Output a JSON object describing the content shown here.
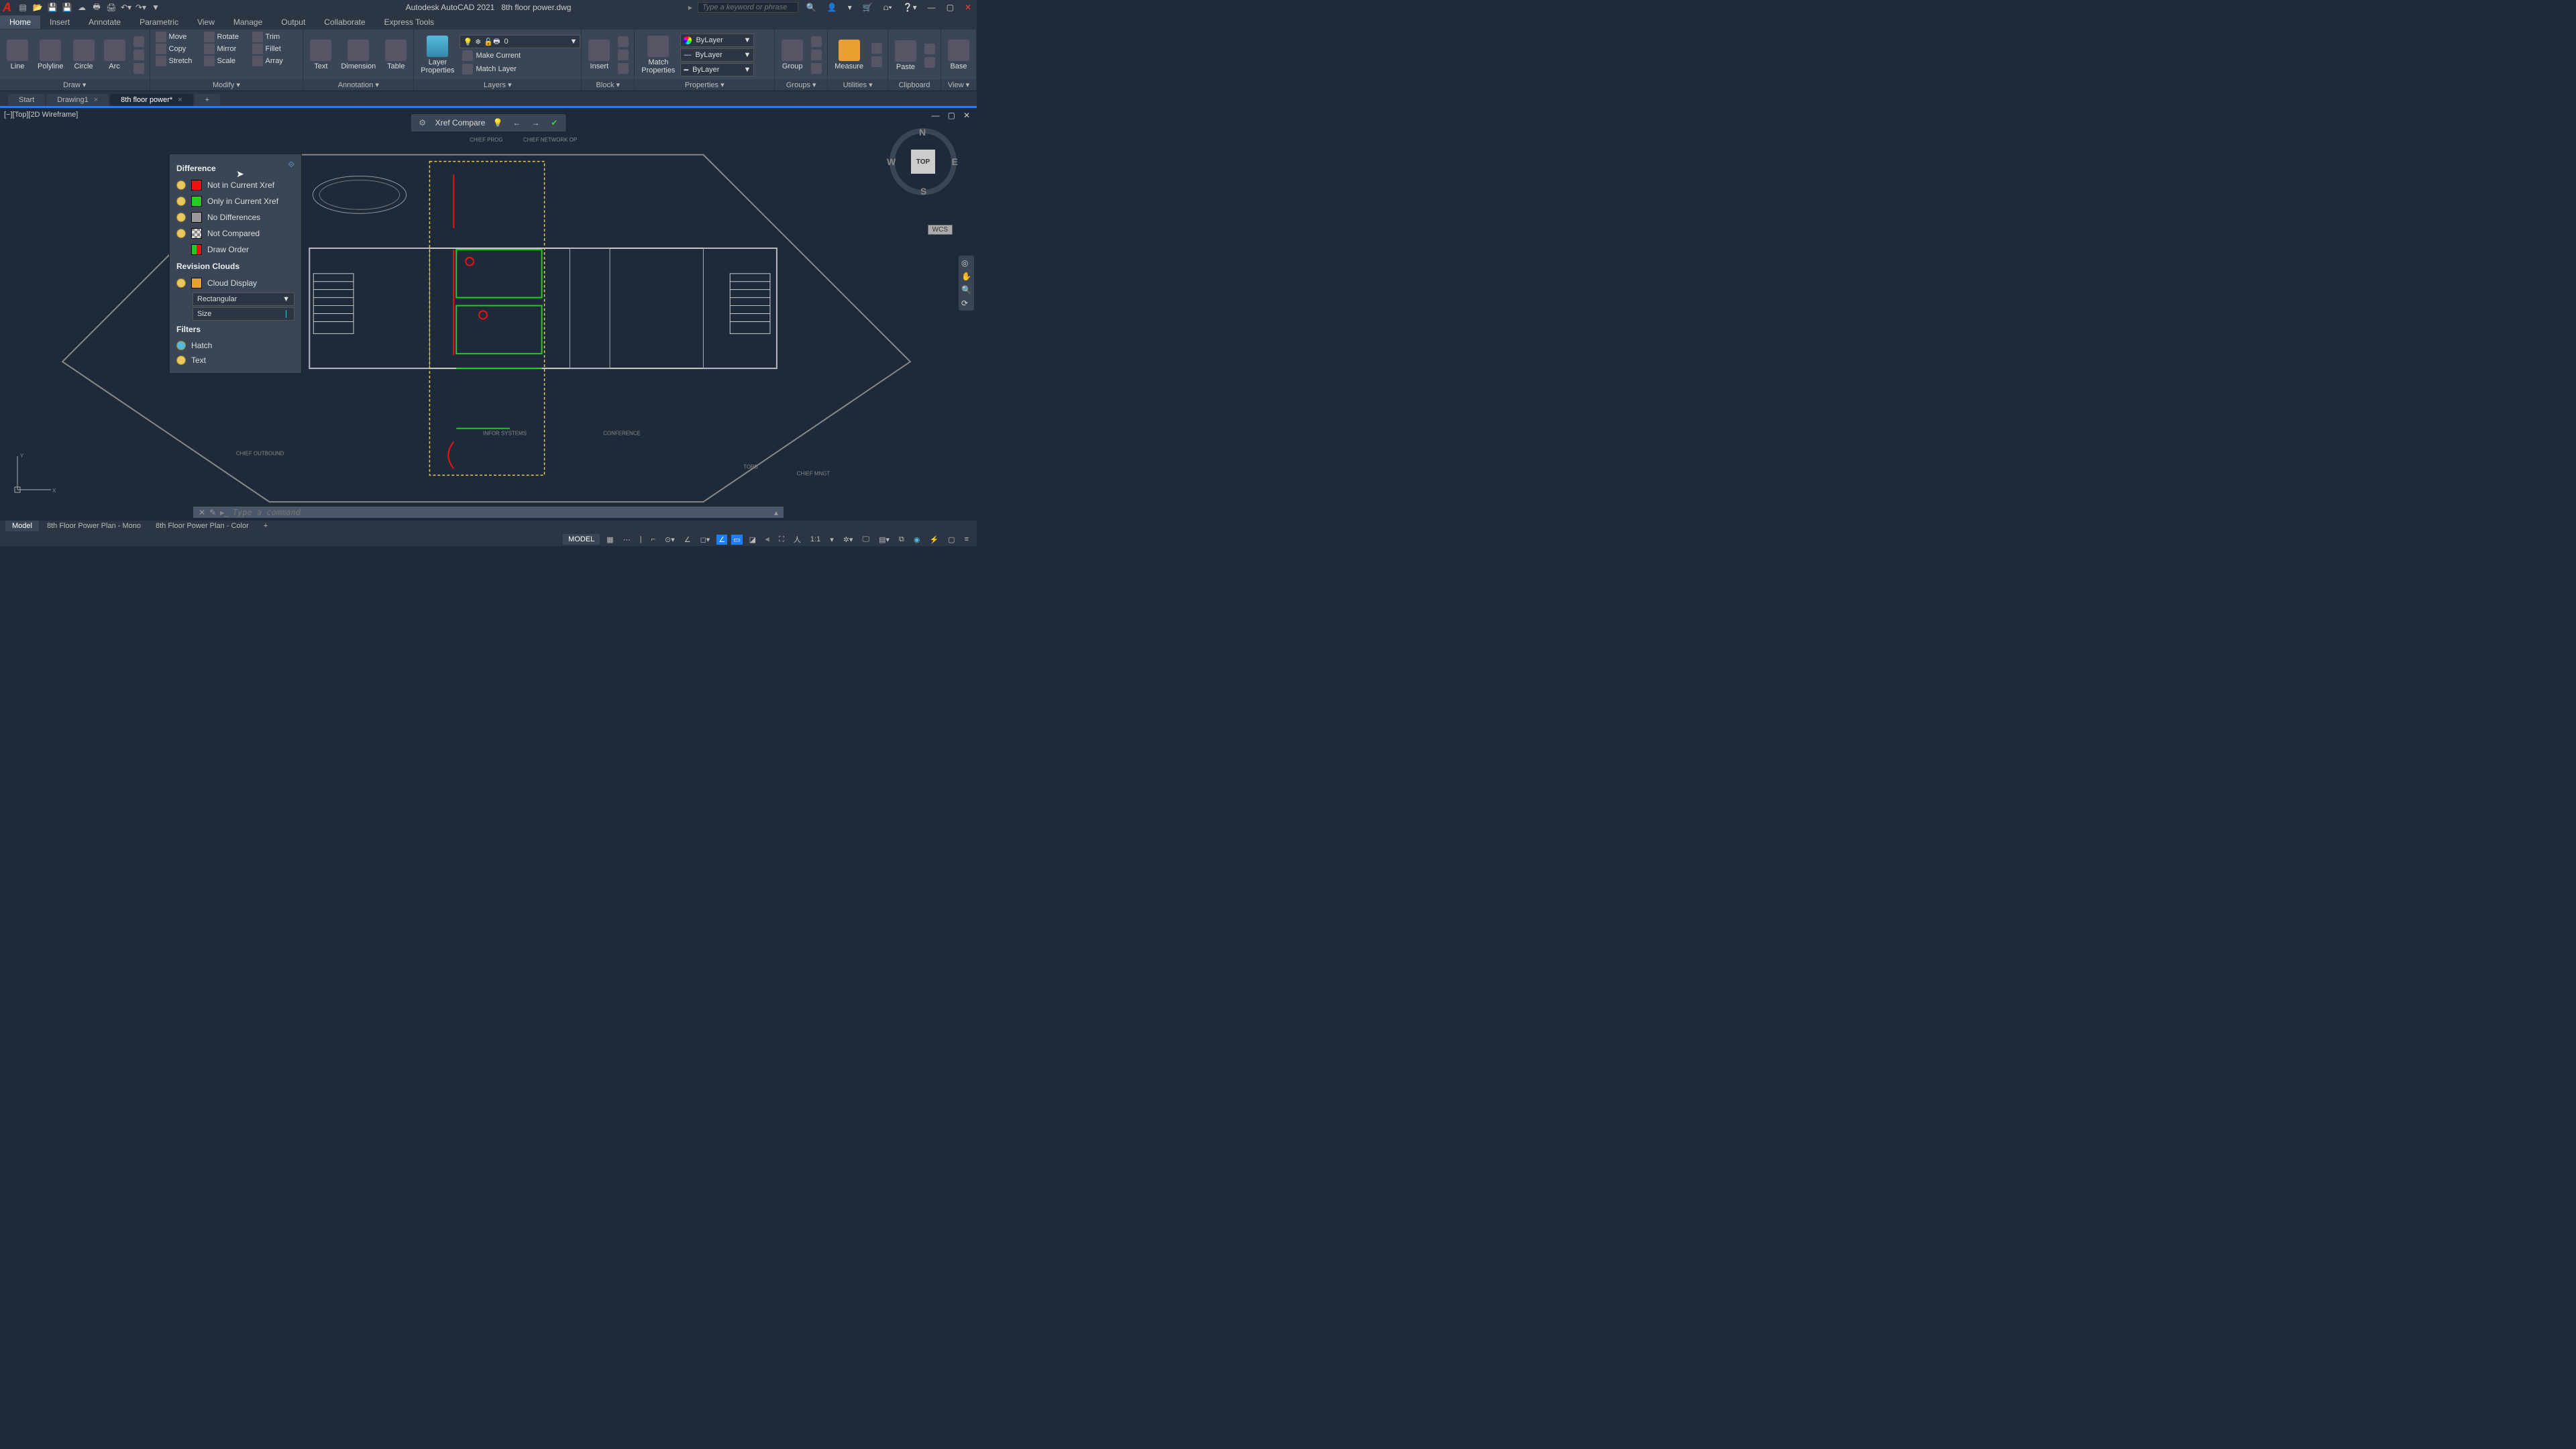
{
  "app": {
    "name": "Autodesk AutoCAD 2021",
    "file": "8th floor power.dwg"
  },
  "search": {
    "placeholder": "Type a keyword or phrase"
  },
  "menu_tabs": [
    "Home",
    "Insert",
    "Annotate",
    "Parametric",
    "View",
    "Manage",
    "Output",
    "Collaborate",
    "Express Tools"
  ],
  "ribbon": {
    "draw": {
      "title": "Draw ▾",
      "items": [
        "Line",
        "Polyline",
        "Circle",
        "Arc"
      ]
    },
    "modify": {
      "title": "Modify ▾",
      "items": [
        [
          "Move",
          "Rotate",
          "Trim"
        ],
        [
          "Copy",
          "Mirror",
          "Fillet"
        ],
        [
          "Stretch",
          "Scale",
          "Array"
        ]
      ]
    },
    "annotation": {
      "title": "Annotation ▾",
      "items": [
        "Text",
        "Dimension",
        "Table"
      ]
    },
    "layers": {
      "title": "Layers ▾",
      "big": "Layer\nProperties",
      "combo_value": "0",
      "rows": [
        "Make Current",
        "Match Layer"
      ]
    },
    "block": {
      "title": "Block ▾",
      "big": "Insert"
    },
    "properties": {
      "title": "Properties ▾",
      "big": "Match\nProperties",
      "rows": [
        "ByLayer",
        "ByLayer",
        "ByLayer"
      ]
    },
    "groups": {
      "title": "Groups ▾",
      "big": "Group"
    },
    "utilities": {
      "title": "Utilities ▾",
      "big": "Measure"
    },
    "clipboard": {
      "title": "Clipboard",
      "big": "Paste"
    },
    "view": {
      "title": "View ▾",
      "big": "Base"
    }
  },
  "doc_tabs": [
    {
      "label": "Start",
      "active": false,
      "closable": false
    },
    {
      "label": "Drawing1",
      "active": false,
      "closable": true
    },
    {
      "label": "8th floor power*",
      "active": true,
      "closable": true
    }
  ],
  "viewport_label": "[−][Top][2D Wireframe]",
  "xref_compare": {
    "label": "Xref Compare"
  },
  "difference_panel": {
    "section1": "Difference",
    "items1": [
      {
        "color": "#e11",
        "label": "Not in Current Xref"
      },
      {
        "color": "#2c2",
        "label": "Only in Current Xref"
      },
      {
        "color": "#999",
        "label": "No Differences"
      },
      {
        "color": "checker",
        "label": "Not Compared"
      },
      {
        "color": "half",
        "label": "Draw Order",
        "no_bulb": true
      }
    ],
    "section2": "Revision Clouds",
    "items2": [
      {
        "color": "#e8a030",
        "label": "Cloud Display"
      }
    ],
    "shape_combo": "Rectangular",
    "size_label": "Size",
    "section3": "Filters",
    "filters": [
      {
        "label": "Hatch",
        "color": "#5bd"
      },
      {
        "label": "Text",
        "color": "#e8c860"
      }
    ]
  },
  "viewcube": {
    "top": "TOP",
    "n": "N",
    "s": "S",
    "e": "E",
    "w": "W"
  },
  "wcs": "WCS",
  "cmdline": {
    "placeholder": "Type a command"
  },
  "layout_tabs": [
    {
      "label": "Model",
      "active": true
    },
    {
      "label": "8th Floor Power Plan - Mono",
      "active": false
    },
    {
      "label": "8th Floor Power Plan - Color",
      "active": false
    }
  ],
  "status": {
    "model": "MODEL",
    "scale": "1:1"
  }
}
